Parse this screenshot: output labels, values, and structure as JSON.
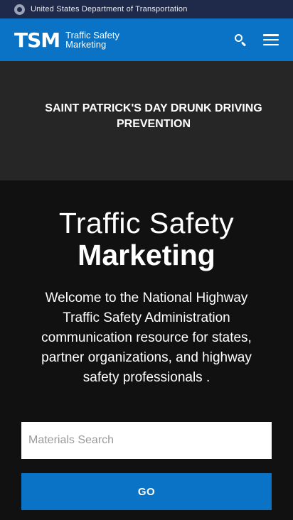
{
  "gov_banner": {
    "seal_icon": "dot-seal-icon",
    "text": "United States Department of Transportation"
  },
  "header": {
    "logo_mark": "TSM",
    "logo_line1": "Traffic Safety",
    "logo_line2": "Marketing",
    "search_icon": "search-icon",
    "menu_icon": "hamburger-menu-icon",
    "background_color": "#0a73c6"
  },
  "campaign": {
    "title": "SAINT PATRICK'S DAY DRUNK DRIVING PREVENTION"
  },
  "hero": {
    "title_light": "Traffic Safety",
    "title_bold": "Marketing",
    "welcome_text": "Welcome to the National Highway Traffic Safety Administration communication resource for states, partner organizations, and highway safety professionals ."
  },
  "search": {
    "placeholder": "Materials Search",
    "value": "",
    "button_label": "GO"
  }
}
